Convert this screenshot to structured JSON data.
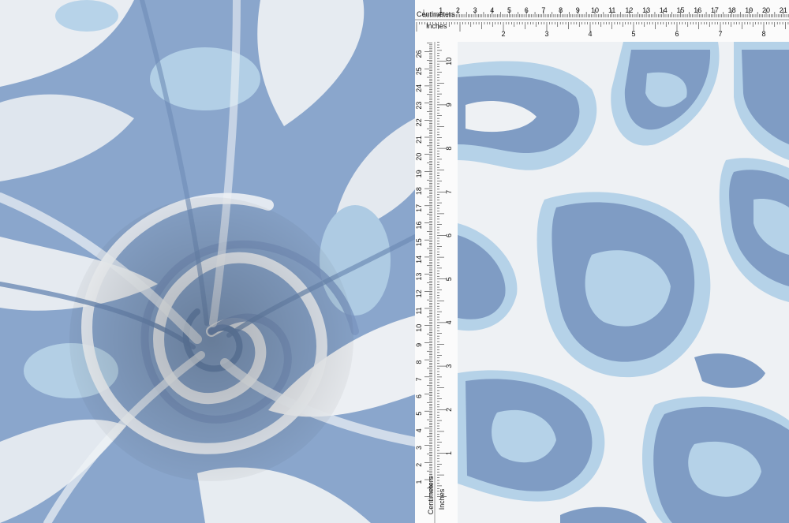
{
  "colors": {
    "cream": "#eef1f4",
    "spot_dark": "#7f9cc4",
    "spot_mid": "#9fb8d8",
    "spot_light": "#b5d2e8",
    "ruler_bg": "#fbfbfb"
  },
  "ruler_top": {
    "units_cm": "Centimeters",
    "units_in": "Inches",
    "cm_numbers": [
      "1",
      "2",
      "3",
      "4",
      "5",
      "6",
      "7",
      "8",
      "9",
      "10",
      "11",
      "12",
      "13",
      "14",
      "15",
      "16",
      "17",
      "18",
      "19",
      "20",
      "21"
    ],
    "in_numbers": [
      "1",
      "2",
      "3",
      "4",
      "5",
      "6",
      "7",
      "8"
    ]
  },
  "ruler_left": {
    "units_cm": "Centimeters",
    "units_in": "Inches",
    "cm_numbers": [
      "1",
      "2",
      "3",
      "4",
      "5",
      "6",
      "7",
      "8",
      "9",
      "10",
      "11",
      "12",
      "13",
      "14",
      "15",
      "16",
      "17",
      "18",
      "19",
      "20",
      "21",
      "22",
      "23",
      "24",
      "25",
      "26",
      "27"
    ],
    "in_numbers": [
      "1",
      "2",
      "3",
      "4",
      "5",
      "6",
      "7",
      "8",
      "9",
      "10"
    ]
  }
}
